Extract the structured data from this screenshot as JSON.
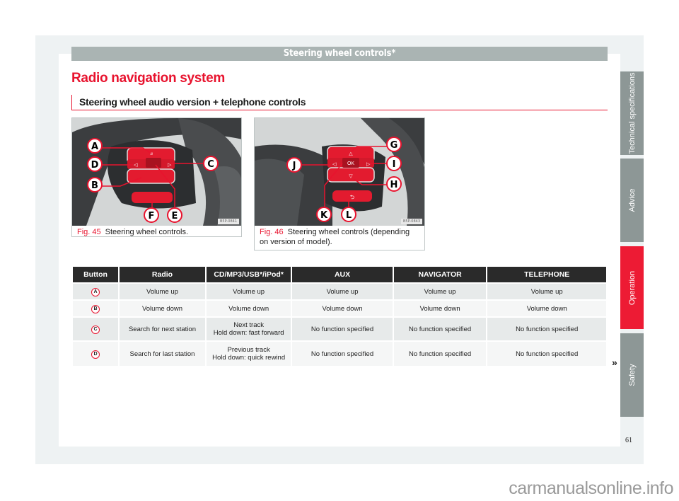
{
  "running_head": "Steering wheel controls*",
  "page_title": "Radio navigation system",
  "section_heading": "Steering wheel audio version + telephone controls",
  "figures": [
    {
      "number": "Fig. 45",
      "caption": "Steering wheel controls.",
      "image_code": "B5P-0841",
      "callouts": [
        "A",
        "B",
        "C",
        "D",
        "E",
        "F"
      ]
    },
    {
      "number": "Fig. 46",
      "caption": "Steering wheel controls (depending on version of model).",
      "image_code": "B5P-0843",
      "callouts": [
        "G",
        "H",
        "I",
        "J",
        "K",
        "L"
      ],
      "ok_label": "OK"
    }
  ],
  "table": {
    "headers": [
      "Button",
      "Radio",
      "CD/MP3/USB*/iPod*",
      "AUX",
      "NAVIGATOR",
      "TELEPHONE"
    ],
    "rows": [
      {
        "button": "A",
        "radio": [
          "Volume up"
        ],
        "cd": [
          "Volume up"
        ],
        "aux": [
          "Volume up"
        ],
        "navigator": [
          "Volume up"
        ],
        "telephone": [
          "Volume up"
        ]
      },
      {
        "button": "B",
        "radio": [
          "Volume down"
        ],
        "cd": [
          "Volume down"
        ],
        "aux": [
          "Volume down"
        ],
        "navigator": [
          "Volume down"
        ],
        "telephone": [
          "Volume down"
        ]
      },
      {
        "button": "C",
        "radio": [
          "Search for next station"
        ],
        "cd": [
          "Next track",
          "Hold down: fast forward"
        ],
        "aux": [
          "No function specified"
        ],
        "navigator": [
          "No function specified"
        ],
        "telephone": [
          "No function specified"
        ]
      },
      {
        "button": "D",
        "radio": [
          "Search for last station"
        ],
        "cd": [
          "Previous track",
          "Hold down: quick rewind"
        ],
        "aux": [
          "No function specified"
        ],
        "navigator": [
          "No function specified"
        ],
        "telephone": [
          "No function specified"
        ]
      }
    ]
  },
  "continue_mark": "»",
  "side_tabs": [
    {
      "label": "Technical specifications",
      "active": false
    },
    {
      "label": "Advice",
      "active": false
    },
    {
      "label": "Operation",
      "active": true
    },
    {
      "label": "Safety",
      "active": false
    }
  ],
  "page_number": "61",
  "watermark": "carmanualsonline.info",
  "colors": {
    "accent_red": "#e8132e",
    "tab_gray": "#8d9796",
    "tab_active": "#ed1b34",
    "running_head_bg": "#aab4b3",
    "table_header_bg": "#2a2a2a"
  }
}
